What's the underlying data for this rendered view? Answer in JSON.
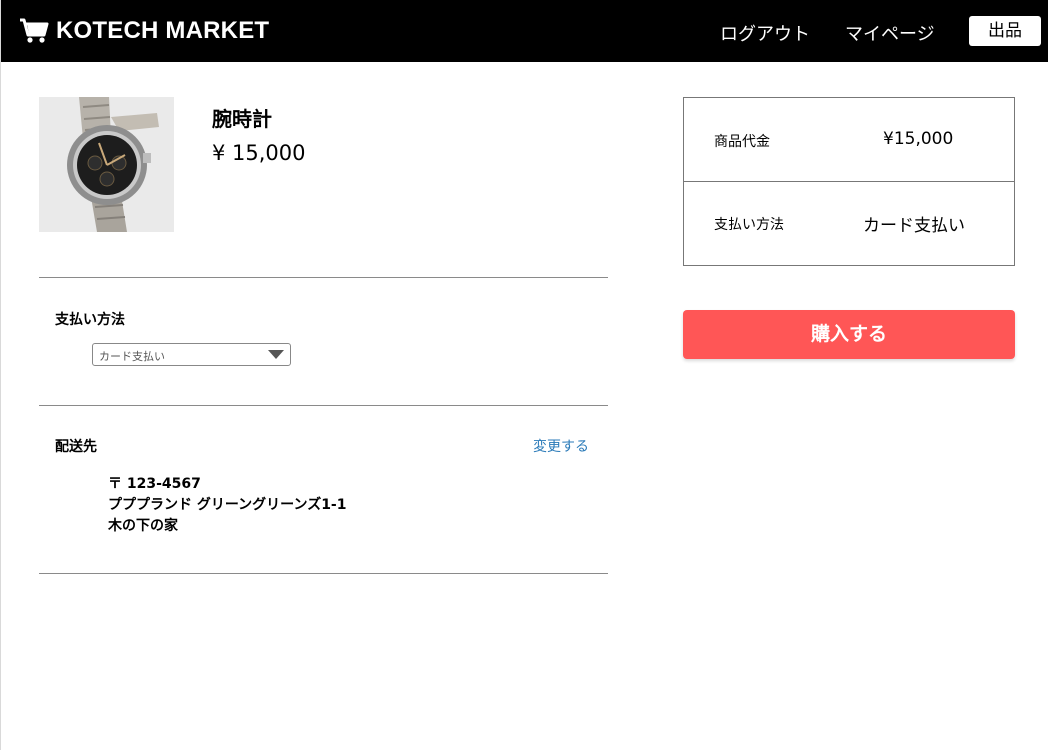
{
  "header": {
    "brand": "KOTECH MARKET",
    "nav": {
      "logout": "ログアウト",
      "mypage": "マイページ",
      "sell": "出品"
    }
  },
  "product": {
    "name": "腕時計",
    "price": "¥ 15,000",
    "image_icon": "wristwatch-image"
  },
  "payment": {
    "label": "支払い方法",
    "selected": "カード支払い"
  },
  "shipping": {
    "label": "配送先",
    "change_link": "変更する",
    "postal": "〒 123-4567",
    "address": "プププランド グリーングリーンズ1-1",
    "building": "木の下の家"
  },
  "summary": {
    "price_label": "商品代金",
    "price_value": "¥15,000",
    "method_label": "支払い方法",
    "method_value": "カード支払い"
  },
  "buy_button": "購入する",
  "colors": {
    "header_bg": "#000000",
    "buy_button": "#ff5656",
    "link": "#2a7ab8"
  }
}
